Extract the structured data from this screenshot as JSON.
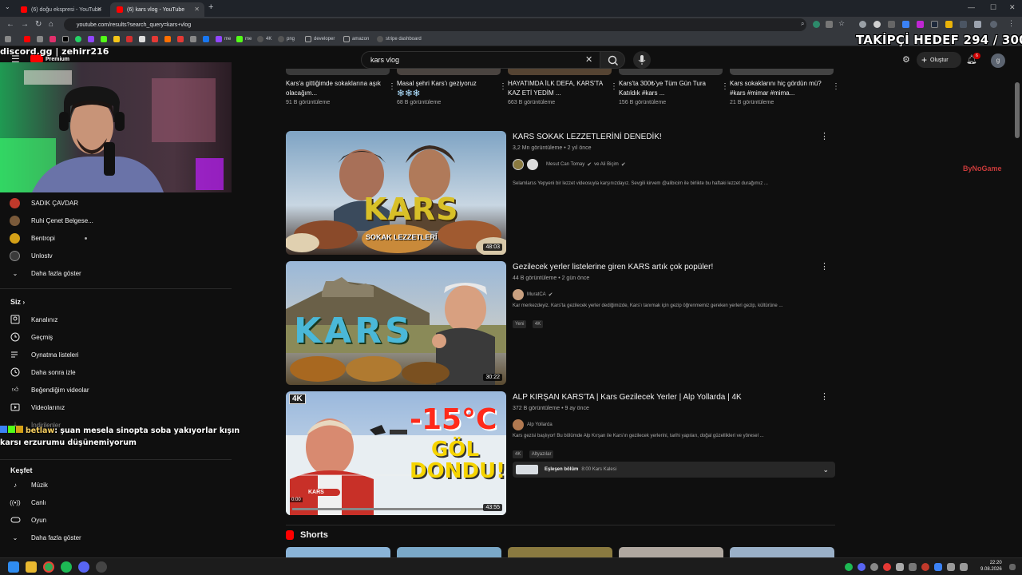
{
  "browser": {
    "tabs": [
      {
        "label": "(6) doğu ekspresi - YouTube"
      },
      {
        "label": "(6) kars vlog - YouTube"
      }
    ],
    "url": "youtube.com/results?search_query=kars+vlog",
    "bookmarks": [
      "me",
      "me",
      "4K",
      "png",
      "developer",
      "amazon",
      "stripe dashboard"
    ]
  },
  "youtube": {
    "logo_suffix": "Premium",
    "search_value": "kars vlog",
    "create_label": "Oluştur",
    "notification_count": "6",
    "avatar_letter": "g"
  },
  "sidebar": {
    "subscriptions": [
      {
        "label": "SADIK ÇAVDAR",
        "color": "#c0392b"
      },
      {
        "label": "Ruhi Çenet Belgese...",
        "color": "#7a5a3a"
      },
      {
        "label": "Bentropi",
        "color": "#d4a017"
      },
      {
        "label": "Unlostv",
        "color": "#3a3a3a"
      }
    ],
    "show_more_1": "Daha fazla göster",
    "you_heading": "Siz",
    "you_items": [
      "Kanalınız",
      "Geçmiş",
      "Oynatma listeleri",
      "Daha sonra izle",
      "Beğendiğim videolar",
      "Videolarınız",
      "İndirilenler"
    ],
    "explore_heading": "Keşfet",
    "explore_items": [
      "Müzik",
      "Canlı",
      "Oyun"
    ],
    "show_more_2": "Daha fazla göster"
  },
  "top_row": [
    {
      "title": "Kars'a gittiğimde sokaklarına aşık olacağım...",
      "views": "91 B görüntüleme"
    },
    {
      "title": "Masal şehri Kars'ı geziyoruz ❄️❄️❄️",
      "views": "68 B görüntüleme"
    },
    {
      "title": "HAYATIMDA İLK DEFA, KARS'TA KAZ ETİ YEDİM ...",
      "views": "663 B görüntüleme"
    },
    {
      "title": "Kars'ta 300₺'ye Tüm Gün Tura Katıldık #kars ...",
      "views": "156 B görüntüleme"
    },
    {
      "title": "Kars sokaklarını hiç gördün mü? #kars #mimar #mima...",
      "views": "21 B görüntüleme"
    }
  ],
  "videos": [
    {
      "title": "KARS SOKAK LEZZETLERİNİ DENEDİK!",
      "meta": "3,2 Mn görüntüleme • 2 yıl önce",
      "channel": "Mesut Can Tomay",
      "channel_extra": "ve Ali Biçim",
      "description": "Selamlarss Yepyeni bir lezzet videosuyla karşınızdayız. Sevgili kirvem @alibicim ile birlikte bu haftaki lezzet durağımız ...",
      "duration": "48:03",
      "thumb_text": "KARS",
      "thumb_sub": "SOKAK LEZZETLERİ"
    },
    {
      "title": "Gezilecek yerler listelerine giren KARS artık çok popüler!",
      "meta": "44 B görüntüleme • 2 gün önce",
      "channel": "MuratCA",
      "description": "Kar merkezdeyiz. Kars'ta gezilecek yerler dediğimizde, Kars'ı tanımak için gezip öğrenmemiz gereken yerleri gezip, kültürüne ...",
      "badges": [
        "Yeni",
        "4K"
      ],
      "duration": "30:22",
      "thumb_text": "KARS"
    },
    {
      "title": "ALP KIRŞAN KARS'TA | Kars Gezilecek Yerler | Alp Yollarda | 4K",
      "meta": "372 B görüntüleme • 9 ay önce",
      "channel": "Alp Yollarda",
      "description": "Kars gezisi başlıyor! Bu bölümde Alp Kırşan ile Kars'ın gezilecek yerlerini, tarihi yapıları, doğal güzellikleri ve yöresel ...",
      "badges": [
        "4K",
        "Altyazılar"
      ],
      "chapter_label": "Eşleşen bölüm",
      "chapter_text": "8:00 Kars Kalesi",
      "duration": "43:55",
      "thumb_big": "-15°C",
      "thumb_line1": "GÖL",
      "thumb_line2": "DONDU!",
      "thumb_4k": "4K",
      "thumb_tag": "KARS",
      "progress_time": "0:00"
    }
  ],
  "shorts_label": "Shorts",
  "overlay": {
    "takipci": "TAKİPÇİ HEDEF 294 / 300",
    "discord": "discord.gg | zehirr216",
    "chat_user": "betlaw",
    "chat_message": ": şuan mesela sinopta soba yakıyorlar kışın karsı erzurumu düşünemiyorum",
    "watermark": "ByNoGame"
  },
  "taskbar": {
    "time": "22:20",
    "date": "9.08.2026"
  }
}
